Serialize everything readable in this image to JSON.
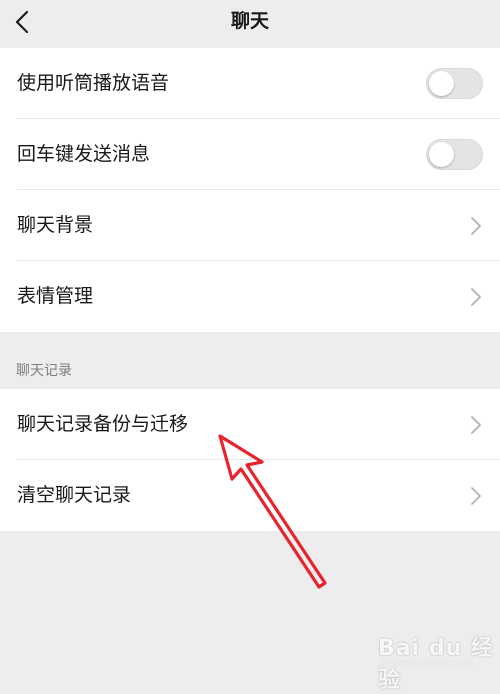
{
  "header": {
    "title": "聊天",
    "back_icon": "chevron-left-icon"
  },
  "settings": {
    "rows": [
      {
        "label": "使用听筒播放语音",
        "control": "toggle",
        "checked": false
      },
      {
        "label": "回车键发送消息",
        "control": "toggle",
        "checked": false
      },
      {
        "label": "聊天背景",
        "control": "chevron-right-icon"
      },
      {
        "label": "表情管理",
        "control": "chevron-right-icon"
      }
    ]
  },
  "chat_history": {
    "section_title": "聊天记录",
    "rows": [
      {
        "label": "聊天记录备份与迁移",
        "control": "chevron-right-icon"
      },
      {
        "label": "清空聊天记录",
        "control": "chevron-right-icon"
      }
    ]
  },
  "annotation": {
    "arrow_color": "#e8232e",
    "icon": "red-arrow-icon"
  },
  "watermark": {
    "text": "Bai du 经验",
    "url": "jingyan.baidu.com"
  },
  "colors": {
    "background": "#ededed",
    "card": "#ffffff",
    "text": "#191919",
    "section_text": "#7f7f7f",
    "toggle_off": "#e4e4e4"
  }
}
